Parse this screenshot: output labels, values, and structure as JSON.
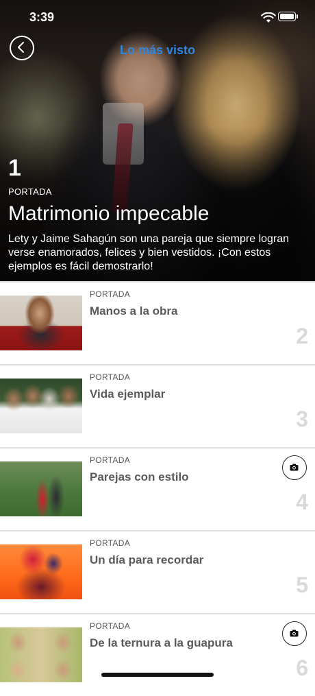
{
  "status": {
    "time": "3:39"
  },
  "nav": {
    "title": "Lo más visto",
    "back_icon": "chevron-left-icon",
    "title_color": "#2e86e0"
  },
  "hero": {
    "rank": "1",
    "category": "PORTADA",
    "title": "Matrimonio impecable",
    "description": "Lety y Jaime Sahagún son una pareja que siempre logran verse enamorados, felices y bien vestidos. ¡Con estos ejemplos es fácil demostrarlo!"
  },
  "articles": [
    {
      "category": "PORTADA",
      "title": "Manos a la obra",
      "rank": "2",
      "gallery": false
    },
    {
      "category": "PORTADA",
      "title": "Vida ejemplar",
      "rank": "3",
      "gallery": false
    },
    {
      "category": "PORTADA",
      "title": "Parejas con estilo",
      "rank": "4",
      "gallery": true,
      "gallery_icon": "camera-icon"
    },
    {
      "category": "PORTADA",
      "title": "Un día para recordar",
      "rank": "5",
      "gallery": false
    },
    {
      "category": "PORTADA",
      "title": "De la ternura a la guapura",
      "rank": "6",
      "gallery": true,
      "gallery_icon": "camera-icon"
    }
  ]
}
